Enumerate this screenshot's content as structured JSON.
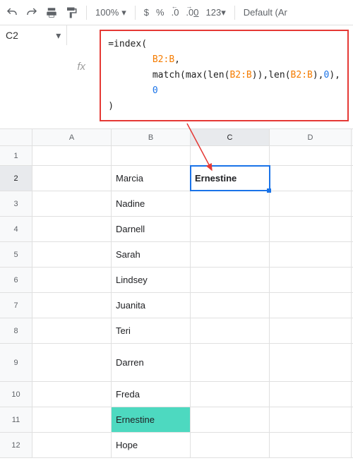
{
  "toolbar": {
    "zoom": "100%",
    "currency": "$",
    "percent": "%",
    "dec_dec": ".0",
    "inc_dec": ".00",
    "format123": "123",
    "font": "Default (Ar"
  },
  "namebox": {
    "ref": "C2"
  },
  "formula": {
    "l1_pre": "=",
    "l1_fn": "index",
    "l1_post": "(",
    "l2_indent": "        ",
    "l2_ref": "B2:B",
    "l2_post": ",",
    "l3_indent": "        ",
    "l3_fn1": "match",
    "l3_p1": "(",
    "l3_fn2": "max",
    "l3_p2": "(",
    "l3_fn3": "len",
    "l3_p3": "(",
    "l3_ref1": "B2:B",
    "l3_p4": ")),",
    "l3_fn4": "len",
    "l3_p5": "(",
    "l3_ref2": "B2:B",
    "l3_p6": "),",
    "l3_num": "0",
    "l3_p7": "),",
    "l4_indent": "        ",
    "l4_num": "0",
    "l5": ")"
  },
  "columns": [
    "A",
    "B",
    "C",
    "D"
  ],
  "rows": [
    {
      "n": 1,
      "b": "",
      "c": ""
    },
    {
      "n": 2,
      "b": "Marcia",
      "c": "Ernestine"
    },
    {
      "n": 3,
      "b": "Nadine",
      "c": ""
    },
    {
      "n": 4,
      "b": "Darnell",
      "c": ""
    },
    {
      "n": 5,
      "b": "Sarah",
      "c": ""
    },
    {
      "n": 6,
      "b": "Lindsey",
      "c": ""
    },
    {
      "n": 7,
      "b": "Juanita",
      "c": ""
    },
    {
      "n": 8,
      "b": "Teri",
      "c": ""
    },
    {
      "n": 9,
      "b": "Darren",
      "c": ""
    },
    {
      "n": 10,
      "b": "Freda",
      "c": ""
    },
    {
      "n": 11,
      "b": "Ernestine",
      "c": ""
    },
    {
      "n": 12,
      "b": "Hope",
      "c": ""
    }
  ],
  "selected_cell": "C2",
  "highlighted_cell": "B11"
}
